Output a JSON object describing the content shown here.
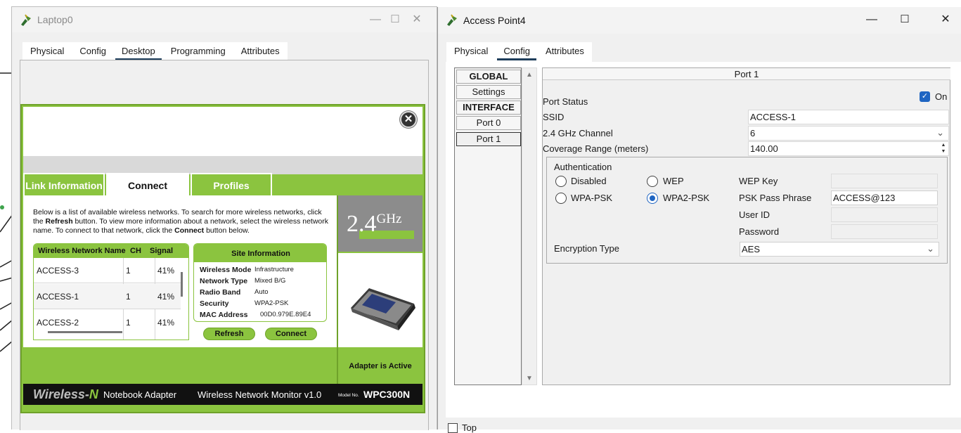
{
  "laptop_window": {
    "title": "Laptop0",
    "controls": {
      "minimize": "—",
      "maximize": "☐",
      "close": "✕"
    },
    "tabs": [
      "Physical",
      "Config",
      "Desktop",
      "Programming",
      "Attributes"
    ],
    "active_tab": "Desktop",
    "monitor": {
      "tabs": [
        "Link Information",
        "Connect",
        "Profiles"
      ],
      "active_tab": "Connect",
      "description_parts": {
        "p1": "Below is a list of available wireless networks. To search for more wireless networks, click the ",
        "refresh": "Refresh",
        "p2": " button. To view more information about a network, select the wireless network name. To connect to that network, click the ",
        "connect": "Connect",
        "p3": " button below."
      },
      "network_list": {
        "columns": [
          "Wireless Network Name",
          "CH",
          "Signal"
        ],
        "rows": [
          {
            "name": "ACCESS-3",
            "ch": "1",
            "signal": "41%"
          },
          {
            "name": "ACCESS-1",
            "ch": "1",
            "signal": "41%"
          },
          {
            "name": "ACCESS-2",
            "ch": "1",
            "signal": "41%"
          }
        ]
      },
      "site_info": {
        "title": "Site Information",
        "rows": [
          {
            "key": "Wireless Mode",
            "value": "Infrastructure"
          },
          {
            "key": "Network Type",
            "value": "Mixed B/G"
          },
          {
            "key": "Radio Band",
            "value": "Auto"
          },
          {
            "key": "Security",
            "value": "WPA2-PSK"
          },
          {
            "key": "MAC Address",
            "value": "00D0.979E.89E4"
          }
        ]
      },
      "buttons": {
        "refresh": "Refresh",
        "connect": "Connect"
      },
      "ghz_label": {
        "number": "2.4",
        "unit": "GHz"
      },
      "adapter_status": "Adapter is Active",
      "footer": {
        "brand_a": "Wireless-",
        "brand_b": "N",
        "product": "Notebook Adapter",
        "monitor_name": "Wireless Network Monitor  v1.0",
        "model_label": "Model No.",
        "model_no": "WPC300N"
      }
    }
  },
  "ap_window": {
    "title": "Access Point4",
    "controls": {
      "minimize": "—",
      "maximize": "☐",
      "close": "✕"
    },
    "tabs": [
      "Physical",
      "Config",
      "Attributes"
    ],
    "active_tab": "Config",
    "left_nav": [
      "GLOBAL",
      "Settings",
      "INTERFACE",
      "Port 0",
      "Port 1"
    ],
    "selected_nav": "Port 1",
    "port": {
      "header": "Port 1",
      "port_status_label": "Port Status",
      "port_status_on": "On",
      "ssid_label": "SSID",
      "ssid_value": "ACCESS-1",
      "channel_label": "2.4 GHz Channel",
      "channel_value": "6",
      "coverage_label": "Coverage Range (meters)",
      "coverage_value": "140.00",
      "auth": {
        "title": "Authentication",
        "options": [
          "Disabled",
          "WEP",
          "WPA-PSK",
          "WPA2-PSK"
        ],
        "selected": "WPA2-PSK",
        "wep_key_label": "WEP Key",
        "wep_key_value": "",
        "psk_label": "PSK Pass Phrase",
        "psk_value": "ACCESS@123",
        "user_id_label": "User ID",
        "password_label": "Password",
        "encryption_label": "Encryption Type",
        "encryption_value": "AES"
      }
    },
    "top_checkbox_label": "Top"
  }
}
